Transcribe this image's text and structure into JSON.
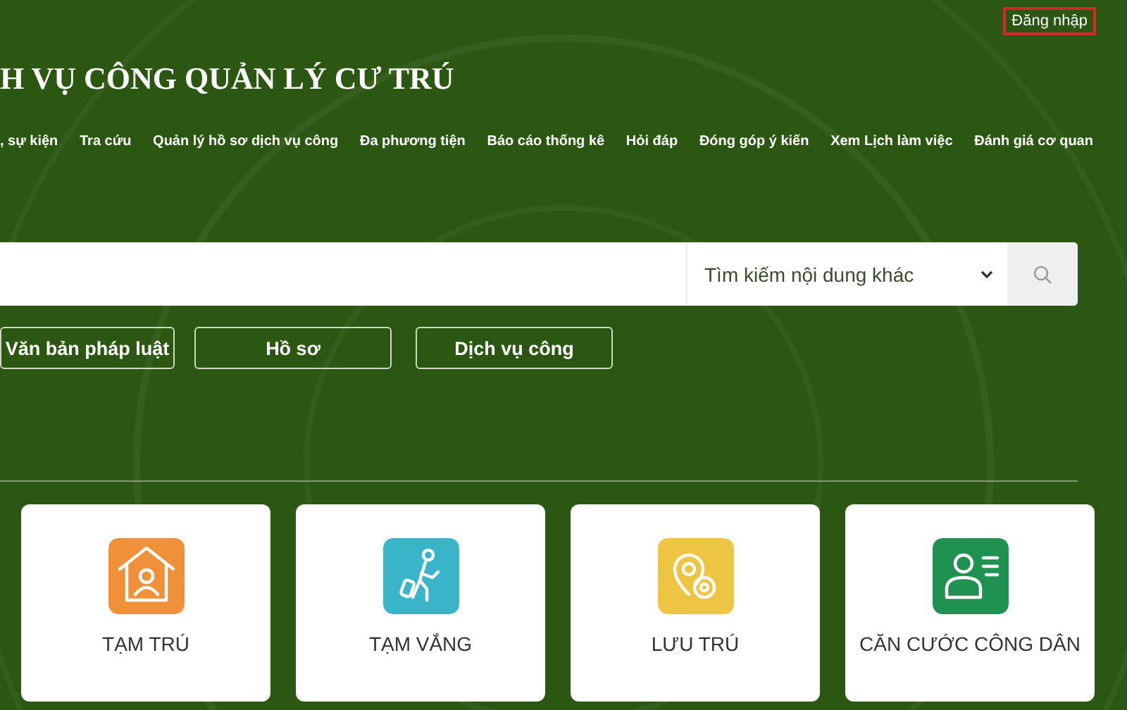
{
  "header": {
    "login": "Đăng nhập",
    "title": "H VỤ CÔNG QUẢN LÝ CƯ TRÚ"
  },
  "nav": [
    ", sự kiện",
    "Tra cứu",
    "Quản lý hồ sơ dịch vụ công",
    "Đa phương tiện",
    "Báo cáo thống kê",
    "Hỏi đáp",
    "Đóng góp ý kiến",
    "Xem Lịch làm việc",
    "Đánh giá cơ quan"
  ],
  "search": {
    "scope": "Tìm kiếm nội dung khác"
  },
  "filters": [
    "Văn bản pháp luật",
    "Hồ sơ",
    "Dịch vụ công"
  ],
  "services": [
    {
      "label": "TẠM TRÚ",
      "color": "#f0913a"
    },
    {
      "label": "TẠM VẮNG",
      "color": "#3ab4c8"
    },
    {
      "label": "LƯU TRÚ",
      "color": "#eec443"
    },
    {
      "label": "CĂN CƯỚC CÔNG DÂN",
      "color": "#1f9150"
    }
  ]
}
